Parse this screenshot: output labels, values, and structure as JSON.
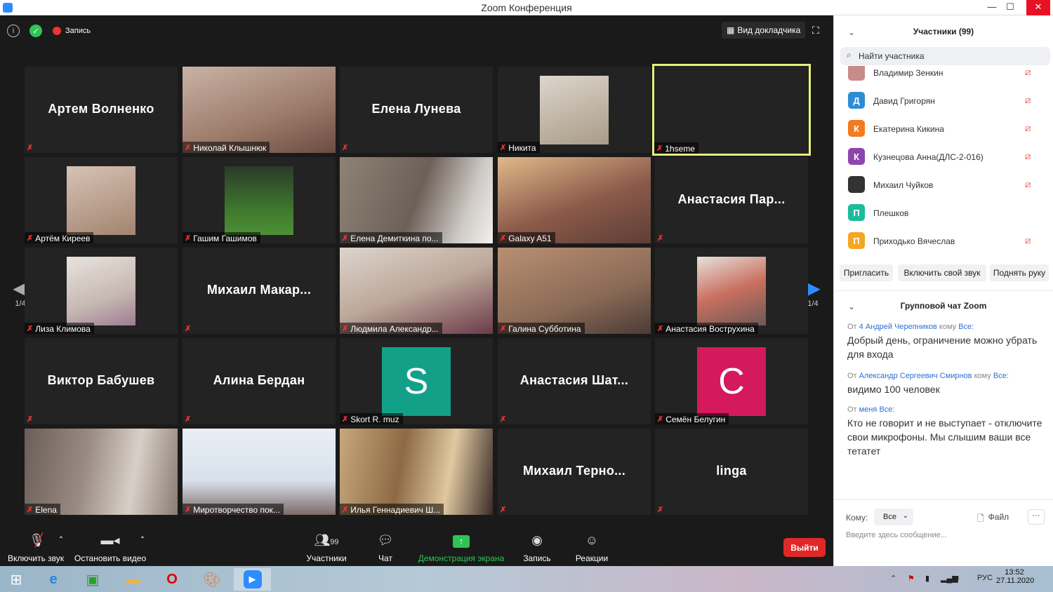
{
  "window": {
    "title": "Zoom Конференция",
    "minimize": "—",
    "maximize": "☐",
    "close": "✕"
  },
  "meeting": {
    "record_label": "Запись",
    "speaker_view_label": "Вид докладчика",
    "page_indicator_left": "1/4",
    "page_indicator_right": "1/4"
  },
  "tiles": [
    {
      "name": "Артем Волненко",
      "mode": "name"
    },
    {
      "name": "Николай Клышнюк",
      "mode": "video"
    },
    {
      "name": "Елена Лунева",
      "mode": "name"
    },
    {
      "name": "Никита",
      "mode": "video"
    },
    {
      "name": "1hseme",
      "mode": "active"
    },
    {
      "name": "Артём Киреев",
      "mode": "video"
    },
    {
      "name": "Гашим Гашимов",
      "mode": "video"
    },
    {
      "name": "Елена Демиткина по...",
      "mode": "video"
    },
    {
      "name": "Galaxy A51",
      "mode": "video"
    },
    {
      "name": "Анастасия Пар...",
      "mode": "name"
    },
    {
      "name": "Лиза Климова",
      "mode": "video"
    },
    {
      "name": "Михаил Макар...",
      "mode": "name"
    },
    {
      "name": "Людмила Александр...",
      "mode": "video"
    },
    {
      "name": "Галина Субботина",
      "mode": "video"
    },
    {
      "name": "Анастасия Вострухина",
      "mode": "video"
    },
    {
      "name": "Виктор Бабушев",
      "mode": "name"
    },
    {
      "name": "Алина Бердан",
      "mode": "name"
    },
    {
      "name": "Skort R. muz",
      "mode": "avatar",
      "letter": "S"
    },
    {
      "name": "Анастасия Шат...",
      "mode": "name"
    },
    {
      "name": "Семён Белугин",
      "mode": "avatar",
      "letter": "C"
    },
    {
      "name": "Elena",
      "mode": "video"
    },
    {
      "name": "Миротворчество пок...",
      "mode": "video"
    },
    {
      "name": "Илья Геннадиевич Ш...",
      "mode": "video"
    },
    {
      "name": "Михаил Терно...",
      "mode": "name"
    },
    {
      "name": "linga",
      "mode": "name"
    }
  ],
  "toolbar": {
    "unmute": "Включить звук",
    "stop_video": "Остановить видео",
    "participants": "Участники",
    "participants_count": "99",
    "chat": "Чат",
    "share": "Демонстрация экрана",
    "record": "Запись",
    "reactions": "Реакции",
    "leave": "Выйти"
  },
  "participants_panel": {
    "title": "Участники (99)",
    "search_placeholder": "Найти участника",
    "list": [
      {
        "name": "Владимир Зенкин",
        "initial": "",
        "color": "#c98a8a"
      },
      {
        "name": "Давид Григорян",
        "initial": "Д",
        "color": "#2d8cd6"
      },
      {
        "name": "Екатерина Кикина",
        "initial": "К",
        "color": "#f47a1f"
      },
      {
        "name": "Кузнецова Анна(ДЛС-2-016)",
        "initial": "К",
        "color": "#8e44ad"
      },
      {
        "name": "Михаил Чуйков",
        "initial": "",
        "color": "#333333"
      },
      {
        "name": "Плешков",
        "initial": "П",
        "color": "#1abc9c"
      },
      {
        "name": "Приходько Вячеслав",
        "initial": "П",
        "color": "#f5a623"
      }
    ],
    "invite": "Пригласить",
    "unmute_me": "Включить свой звук",
    "raise_hand": "Поднять руку"
  },
  "chat_panel": {
    "title": "Групповой чат Zoom",
    "from_word": "От",
    "to_word": "кому",
    "messages": [
      {
        "sender": "4 Андрей Черепников",
        "to": "Все:",
        "text": "Добрый день, ограничение можно убрать для входа"
      },
      {
        "sender": "Александр Сергеевич Смирнов",
        "to": "Все:",
        "text": "видимо 100 человек"
      },
      {
        "sender": "меня",
        "to": "Все:",
        "text": "Кто не говорит и не выступает - отключите свои микрофоны. Мы слышим ваши все тетатет"
      }
    ],
    "to_label": "Кому:",
    "to_value": "Все",
    "file_label": "Файл",
    "input_placeholder": "Введите здесь сообщение..."
  },
  "taskbar": {
    "lang": "РУС",
    "time": "13:52",
    "date": "27.11.2020"
  },
  "colors": {
    "accent": "#2d8cff",
    "leave": "#e02828",
    "share": "#2ec455",
    "active_border": "#e6f07a"
  }
}
